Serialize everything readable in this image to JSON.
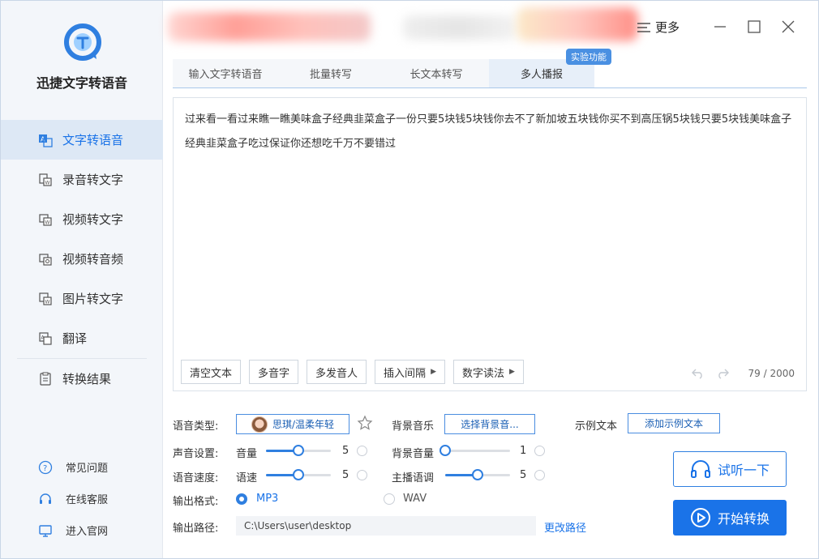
{
  "app": {
    "name": "迅捷文字转语音"
  },
  "titlebar": {
    "more_label": "更多"
  },
  "sidebar": {
    "items": [
      {
        "label": "文字转语音",
        "icon": "text-to-speech-icon",
        "active": true
      },
      {
        "label": "录音转文字",
        "icon": "recording-icon"
      },
      {
        "label": "视频转文字",
        "icon": "video-text-icon"
      },
      {
        "label": "视频转音频",
        "icon": "video-audio-icon"
      },
      {
        "label": "图片转文字",
        "icon": "image-text-icon"
      },
      {
        "label": "翻译",
        "icon": "translate-icon"
      },
      {
        "label": "转换结果",
        "icon": "result-icon"
      }
    ],
    "links": [
      {
        "label": "常见问题",
        "icon": "question-icon"
      },
      {
        "label": "在线客服",
        "icon": "headset-icon"
      },
      {
        "label": "进入官网",
        "icon": "monitor-icon"
      }
    ]
  },
  "tabs": [
    {
      "label": "输入文字转语音"
    },
    {
      "label": "批量转写"
    },
    {
      "label": "长文本转写"
    },
    {
      "label": "多人播报",
      "active": true
    }
  ],
  "badge": "实验功能",
  "editor": {
    "text": "过来看一看过来瞧一瞧美味盒子经典韭菜盒子一份只要5块钱5块钱你去不了新加坡五块钱你买不到高压锅5块钱只要5块钱美味盒子经典韭菜盒子吃过保证你还想吃千万不要错过",
    "buttons": [
      "清空文本",
      "多音字",
      "多发音人",
      "插入间隔",
      "数字读法"
    ],
    "count": "79",
    "max": "/ 2000"
  },
  "settings": {
    "voice_type_label": "语音类型:",
    "voice_name": "思琪/温柔年轻",
    "bgm_label": "背景音乐",
    "bgm_button": "选择背景音...",
    "example_label": "示例文本",
    "example_button": "添加示例文本",
    "sound_label": "声音设置:",
    "volume_label": "音量",
    "volume_value": "5",
    "volume_fraction": 0.5,
    "bg_volume_label": "背景音量",
    "bg_volume_value": "1",
    "bg_volume_fraction": 0.0,
    "speed_label": "语音速度:",
    "speed_sub": "语速",
    "speed_value": "5",
    "speed_fraction": 0.5,
    "tone_label": "主播语调",
    "tone_value": "5",
    "tone_fraction": 0.5,
    "format_label": "输出格式:",
    "format_mp3": "MP3",
    "format_wav": "WAV",
    "format_selected": "MP3",
    "path_label": "输出路径:",
    "path_value": "C:\\Users\\user\\desktop",
    "change_path": "更改路径"
  },
  "actions": {
    "preview": "试听一下",
    "start": "开始转换"
  },
  "colors": {
    "accent": "#1a73e8",
    "sidebar_bg": "#f3f6fa",
    "active_bg": "#dde8f5"
  }
}
